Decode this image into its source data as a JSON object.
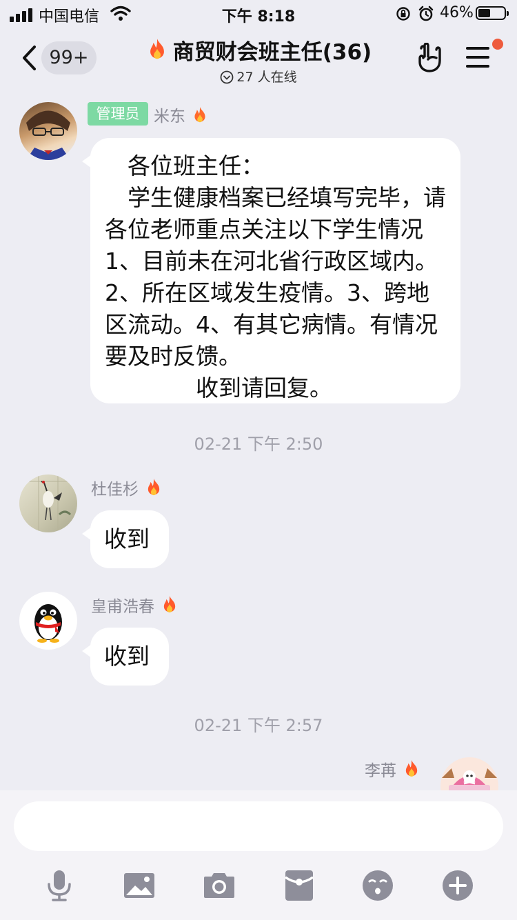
{
  "status_bar": {
    "carrier": "中国电信",
    "time": "下午 8:18",
    "battery": "46%"
  },
  "nav": {
    "unread_count": "99+",
    "group_title": "商贸财会班主任(36)",
    "online_status": "27 人在线",
    "notification_dot_color": "#ee5b3d"
  },
  "messages": [
    {
      "sender": "米东",
      "role_badge": "管理员",
      "text": "　各位班主任：\n　学生健康档案已经填写完毕，请各位老师重点关注以下学生情况1、目前未在河北省行政区域内。2、所在区域发生疫情。3、跨地区流动。4、有其它病情。有情况要及时反馈。\n　　　　收到请回复。"
    },
    {
      "timestamp": "02-21 下午 2:50"
    },
    {
      "sender": "杜佳杉",
      "text": "收到"
    },
    {
      "sender": "皇甫浩春",
      "text": "收到"
    },
    {
      "timestamp": "02-21 下午 2:57"
    },
    {
      "sender": "李苒"
    }
  ],
  "input": {
    "value": "",
    "placeholder": ""
  },
  "toolbar_icons": [
    "microphone-icon",
    "image-icon",
    "camera-icon",
    "red-packet-icon",
    "emoji-icon",
    "plus-icon"
  ],
  "colors": {
    "admin_badge": "#7dd9a3",
    "background": "#ededf3",
    "bubble": "#ffffff"
  }
}
